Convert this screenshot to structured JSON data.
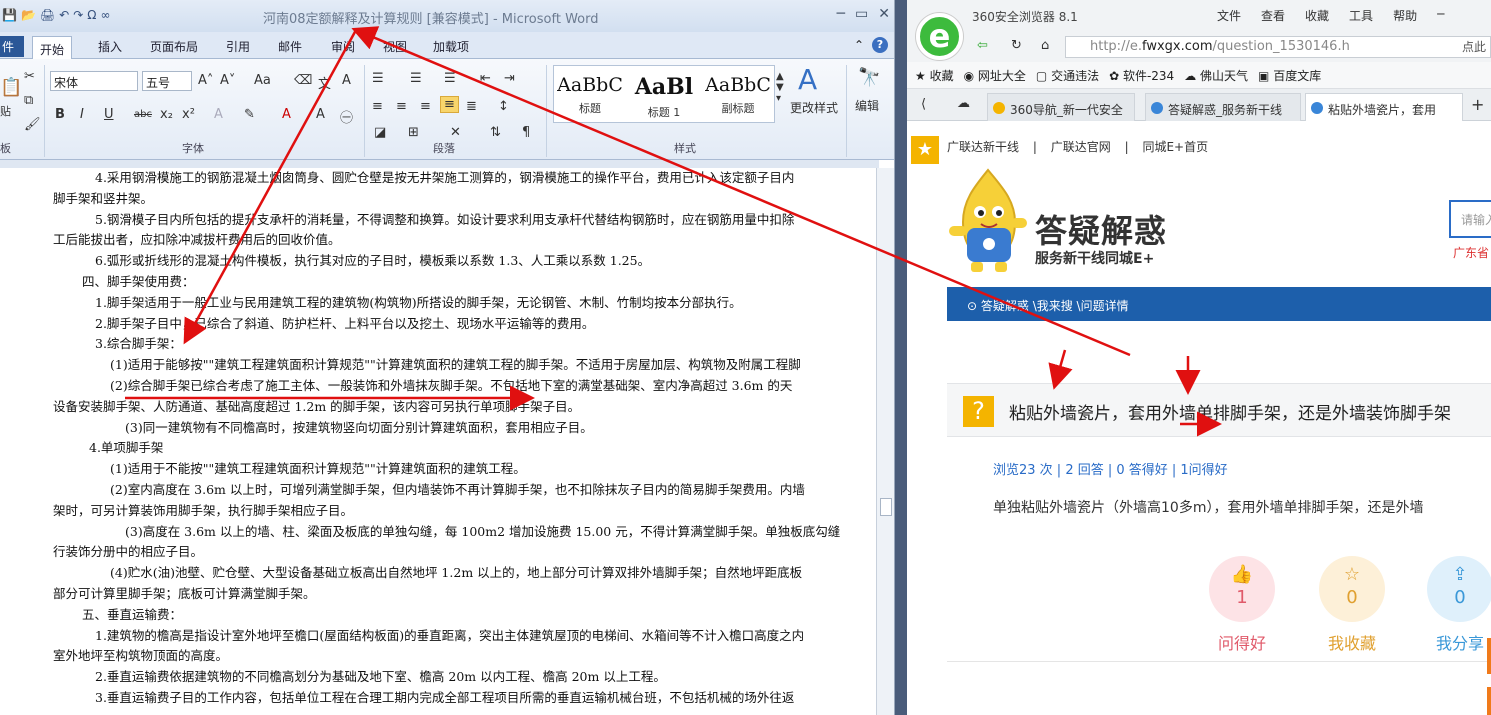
{
  "word": {
    "title": "河南08定额解释及计算规则 [兼容模式] - Microsoft Word",
    "qat": [
      "💾",
      "📂",
      "🖨",
      "↶",
      "↷",
      "Ω",
      "∞"
    ],
    "window_controls": [
      "─",
      "▭",
      "✕"
    ],
    "file_tab": "件",
    "tabs": [
      "开始",
      "插入",
      "页面布局",
      "引用",
      "邮件",
      "审阅",
      "视图",
      "加载项"
    ],
    "ribbon": {
      "paste_label": "贴",
      "font_name": "宋体",
      "font_size": "五号",
      "group_clipboard": "板",
      "group_font": "字体",
      "group_paragraph": "段落",
      "group_styles": "样式",
      "styles": [
        {
          "preview": "AaBbC",
          "label": "标题"
        },
        {
          "preview": "AaBl",
          "label": "标题 1"
        },
        {
          "preview": "AaBbC",
          "label": "副标题"
        }
      ],
      "change_styles": "更改样式",
      "edit": "编辑"
    },
    "doc_lines": [
      "4.采用钢滑模施工的钢筋混凝土烟囱筒身、圆贮仓壁是按无井架施工测算的，钢滑模施工的操作平台，费用已计入该定额子目内",
      "脚手架和竖井架。",
      "5.钢滑模子目内所包括的提升支承杆的消耗量，不得调整和换算。如设计要求利用支承杆代替结构钢筋时，应在钢筋用量中扣除",
      "工后能拔出者，应扣除冲减拔杆费用后的回收价值。",
      "6.弧形或折线形的混凝土构件模板，执行其对应的子目时，模板乘以系数 1.3、人工乘以系数 1.25。",
      "四、脚手架使用费：",
      "1.脚手架适用于一般工业与民用建筑工程的建筑物(构筑物)所搭设的脚手架，无论钢管、木制、竹制均按本分部执行。",
      "2.脚手架子目中，已综合了斜道、防护栏杆、上料平台以及挖土、现场水平运输等的费用。",
      "3.综合脚手架：",
      "(1)适用于能够按\"\"建筑工程建筑面积计算规范\"\"计算建筑面积的建筑工程的脚手架。不适用于房屋加层、构筑物及附属工程脚",
      "(2)综合脚手架已综合考虑了施工主体、一般装饰和外墙抹灰脚手架。不包括地下室的满堂基础架、室内净高超过 3.6m 的天",
      "设备安装脚手架、人防通道、基础高度超过 1.2m 的脚手架，该内容可另执行单项脚手架子目。",
      "(3)同一建筑物有不同檐高时，按建筑物竖向切面分别计算建筑面积，套用相应子目。",
      "4.单项脚手架",
      "(1)适用于不能按\"\"建筑工程建筑面积计算规范\"\"计算建筑面积的建筑工程。",
      "(2)室内高度在 3.6m 以上时，可增列满堂脚手架，但内墙装饰不再计算脚手架，也不扣除抹灰子目内的简易脚手架费用。内墙",
      "架时，可另计算装饰用脚手架，执行脚手架相应子目。",
      "(3)高度在 3.6m 以上的墙、柱、梁面及板底的单独勾缝，每 100m2 增加设施费 15.00 元，不得计算满堂脚手架。单独板底勾缝",
      "行装饰分册中的相应子目。",
      "(4)贮水(油)池壁、贮仓壁、大型设备基础立板高出自然地坪 1.2m 以上的，地上部分可计算双排外墙脚手架；自然地坪距底板",
      "部分可计算里脚手架；底板可计算满堂脚手架。",
      "五、垂直运输费：",
      "1.建筑物的檐高是指设计室外地坪至檐口(屋面结构板面)的垂直距离，突出主体建筑屋顶的电梯间、水箱间等不计入檐口高度之内",
      "室外地坪至构筑物顶面的高度。",
      "2.垂直运输费依据建筑物的不同檐高划分为基础及地下室、檐高 20m 以内工程、檐高 20m 以上工程。",
      "3.垂直运输费子目的工作内容，包括单位工程在合理工期内完成全部工程项目所需的垂直运输机械台班，不包括机械的场外往返"
    ]
  },
  "browser": {
    "name": "360安全浏览器 8.1",
    "menu": [
      "文件",
      "查看",
      "收藏",
      "工具",
      "帮助"
    ],
    "url_prefix": "http://e.",
    "url_domain": "fwxgx.com",
    "url_path": "/question_1530146.h",
    "addr_extra": "点此",
    "bookmarks": [
      "收藏",
      "网址大全",
      "交通违法",
      "软件-234",
      "佛山天气",
      "百度文库"
    ],
    "tabs": [
      "360导航_新一代安全",
      "答疑解惑_服务新干线",
      "粘贴外墙瓷片，套用"
    ],
    "page": {
      "toplinks": [
        "广联达新干线",
        "广联达官网",
        "同城E+首页"
      ],
      "brand": "答疑解惑",
      "slogan": "服务新干线同城E+",
      "search_placeholder": "请输入",
      "area": "广东省",
      "breadcrumb": "答疑解惑 \\我来搜 \\问题详情",
      "question": "粘贴外墙瓷片，套用外墙单排脚手架，还是外墙装饰脚手架",
      "stats": "浏览23 次 | 2 回答 | 0 答得好 | 1问得好",
      "desc": "单独粘贴外墙瓷片（外墙高10多m），套用外墙单排脚手架，还是外墙",
      "actions": [
        {
          "icon": "👍",
          "count": "1",
          "label": "问得好",
          "color": "#e05a6a",
          "bg": "#fde3e6"
        },
        {
          "icon": "☆",
          "count": "0",
          "label": "我收藏",
          "color": "#e0a030",
          "bg": "#fdf0d8"
        },
        {
          "icon": "⇪",
          "count": "0",
          "label": "我分享",
          "color": "#3a98d8",
          "bg": "#dff0fb"
        }
      ]
    }
  }
}
